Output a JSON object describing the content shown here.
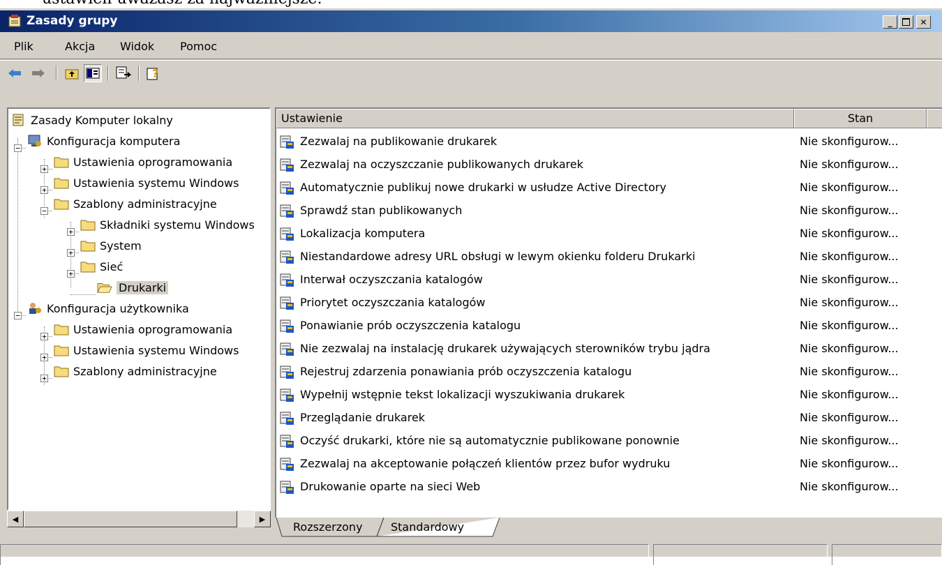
{
  "window": {
    "title": "Zasady grupy"
  },
  "menu": [
    "Plik",
    "Akcja",
    "Widok",
    "Pomoc"
  ],
  "tree": [
    {
      "label": "Zasady Komputer lokalny"
    },
    {
      "label": "Konfiguracja komputera"
    },
    {
      "label": "Ustawienia oprogramowania"
    },
    {
      "label": "Ustawienia systemu Windows"
    },
    {
      "label": "Szablony administracyjne"
    },
    {
      "label": "Składniki systemu Windows"
    },
    {
      "label": "System"
    },
    {
      "label": "Sieć"
    },
    {
      "label": "Drukarki"
    },
    {
      "label": "Konfiguracja użytkownika"
    },
    {
      "label": "Ustawienia oprogramowania"
    },
    {
      "label": "Ustawienia systemu Windows"
    },
    {
      "label": "Szablony administracyjne"
    }
  ],
  "list": {
    "columns": {
      "setting": "Ustawienie",
      "state": "Stan"
    },
    "rows": [
      {
        "name": "Zezwalaj na publikowanie drukarek",
        "state": "Nie skonfigurow..."
      },
      {
        "name": "Zezwalaj na oczyszczanie publikowanych drukarek",
        "state": "Nie skonfigurow..."
      },
      {
        "name": "Automatycznie publikuj nowe drukarki w usłudze Active Directory",
        "state": "Nie skonfigurow..."
      },
      {
        "name": "Sprawdź stan publikowanych",
        "state": "Nie skonfigurow..."
      },
      {
        "name": "Lokalizacja komputera",
        "state": "Nie skonfigurow..."
      },
      {
        "name": "Niestandardowe adresy URL obsługi w lewym okienku folderu Drukarki",
        "state": "Nie skonfigurow..."
      },
      {
        "name": "Interwał oczyszczania katalogów",
        "state": "Nie skonfigurow..."
      },
      {
        "name": "Priorytet oczyszczania katalogów",
        "state": "Nie skonfigurow..."
      },
      {
        "name": "Ponawianie prób oczyszczenia katalogu",
        "state": "Nie skonfigurow..."
      },
      {
        "name": "Nie zezwalaj na instalację drukarek używających sterowników trybu jądra",
        "state": "Nie skonfigurow..."
      },
      {
        "name": "Rejestruj zdarzenia ponawiania prób oczyszczenia katalogu",
        "state": "Nie skonfigurow..."
      },
      {
        "name": "Wypełnij wstępnie tekst lokalizacji wyszukiwania drukarek",
        "state": "Nie skonfigurow..."
      },
      {
        "name": "Przeglądanie drukarek",
        "state": "Nie skonfigurow..."
      },
      {
        "name": "Oczyść drukarki, które nie są automatycznie publikowane ponownie",
        "state": "Nie skonfigurow..."
      },
      {
        "name": "Zezwalaj na akceptowanie połączeń klientów przez bufor wydruku",
        "state": "Nie skonfigurow..."
      },
      {
        "name": "Drukowanie oparte na sieci Web",
        "state": "Nie skonfigurow..."
      }
    ]
  },
  "tabs": {
    "extended": "Rozszerzony",
    "standard": "Standardowy"
  },
  "icons": [
    "policy-app-icon",
    "minimize-icon",
    "maximize-icon",
    "close-icon",
    "back-arrow-icon",
    "forward-arrow-icon",
    "up-folder-icon",
    "show-tree-icon",
    "export-list-icon",
    "help-icon",
    "policy-root-icon",
    "computer-config-icon",
    "user-config-icon",
    "folder-icon",
    "open-folder-icon",
    "policy-setting-icon",
    "scroll-left-icon",
    "scroll-right-icon"
  ]
}
